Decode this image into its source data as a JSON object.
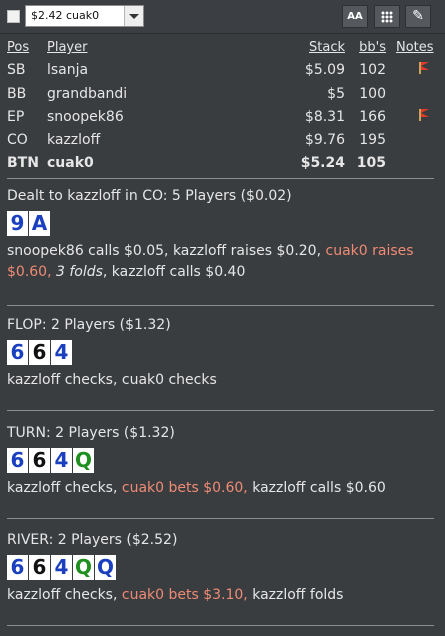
{
  "toolbar": {
    "selected_hand": "$2.42 cuak0",
    "font_button": "AA"
  },
  "table": {
    "headers": {
      "pos": "Pos",
      "player": "Player",
      "stack": "Stack",
      "bbs": "bb's",
      "notes": "Notes"
    },
    "rows": [
      {
        "pos": "SB",
        "player": "lsanja",
        "stack": "$5.09",
        "bbs": "102",
        "note_flag": true
      },
      {
        "pos": "BB",
        "player": "grandbandi",
        "stack": "$5",
        "bbs": "100",
        "note_flag": false
      },
      {
        "pos": "EP",
        "player": "snoopek86",
        "stack": "$8.31",
        "bbs": "166",
        "note_flag": true
      },
      {
        "pos": "CO",
        "player": "kazzloff",
        "stack": "$9.76",
        "bbs": "195",
        "note_flag": false
      },
      {
        "pos": "BTN",
        "player": "cuak0",
        "stack": "$5.24",
        "bbs": "105",
        "note_flag": false,
        "hero": true
      }
    ]
  },
  "preflop": {
    "title": "Dealt to kazzloff in CO: 5 Players ($0.02)",
    "cards": [
      {
        "rank": "9",
        "suit": "d"
      },
      {
        "rank": "A",
        "suit": "d"
      }
    ],
    "actions": [
      {
        "text": "snoopek86 calls $0.05, kazzloff raises $0.20, ",
        "style": ""
      },
      {
        "text": "cuak0 raises $0.60, ",
        "style": "hl"
      },
      {
        "text": "3 folds",
        "style": "it"
      },
      {
        "text": ", kazzloff calls $0.40",
        "style": ""
      }
    ]
  },
  "flop": {
    "title": "FLOP: 2 Players ($1.32)",
    "cards": [
      {
        "rank": "6",
        "suit": "d"
      },
      {
        "rank": "6",
        "suit": "s"
      },
      {
        "rank": "4",
        "suit": "d"
      }
    ],
    "actions": [
      {
        "text": "kazzloff checks, cuak0 checks",
        "style": ""
      }
    ]
  },
  "turn": {
    "title": "TURN: 2 Players ($1.32)",
    "cards": [
      {
        "rank": "6",
        "suit": "d"
      },
      {
        "rank": "6",
        "suit": "s"
      },
      {
        "rank": "4",
        "suit": "d"
      },
      {
        "rank": "Q",
        "suit": "c"
      }
    ],
    "actions": [
      {
        "text": "kazzloff checks, ",
        "style": ""
      },
      {
        "text": "cuak0 bets $0.60, ",
        "style": "hl"
      },
      {
        "text": "kazzloff calls $0.60",
        "style": ""
      }
    ]
  },
  "river": {
    "title": "RIVER: 2 Players ($2.52)",
    "cards": [
      {
        "rank": "6",
        "suit": "d"
      },
      {
        "rank": "6",
        "suit": "s"
      },
      {
        "rank": "4",
        "suit": "d"
      },
      {
        "rank": "Q",
        "suit": "c"
      },
      {
        "rank": "Q",
        "suit": "d"
      }
    ],
    "actions": [
      {
        "text": "kazzloff checks, ",
        "style": ""
      },
      {
        "text": "cuak0 bets $3.10, ",
        "style": "hl"
      },
      {
        "text": "kazzloff folds",
        "style": ""
      }
    ]
  },
  "colors": {
    "highlight": "#ef8b75",
    "diamond": "#1a3fbf",
    "spade": "#111111",
    "club": "#1f8f1f"
  },
  "icons": {
    "notes_flag": "flag-icon",
    "grid": "grid-icon",
    "edit": "pencil-icon",
    "dropdown": "chevron-down-icon"
  }
}
